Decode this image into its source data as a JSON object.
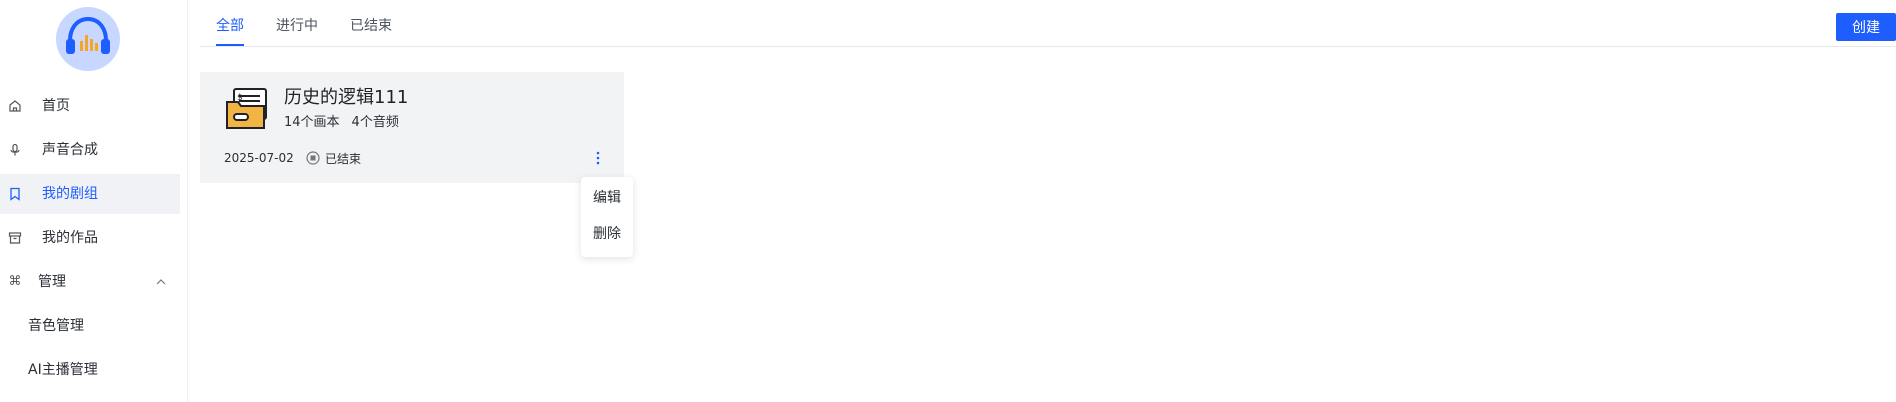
{
  "sidebar": {
    "items": [
      {
        "label": "首页",
        "icon": "home-icon"
      },
      {
        "label": "声音合成",
        "icon": "microphone-icon"
      },
      {
        "label": "我的剧组",
        "icon": "bookmark-icon",
        "active": true
      },
      {
        "label": "我的作品",
        "icon": "archive-icon"
      }
    ],
    "group": {
      "label": "管理",
      "icon": "command-icon",
      "expanded": true,
      "children": [
        {
          "label": "音色管理"
        },
        {
          "label": "AI主播管理"
        }
      ]
    }
  },
  "tabs": [
    {
      "label": "全部",
      "active": true
    },
    {
      "label": "进行中"
    },
    {
      "label": "已结束"
    }
  ],
  "create_label": "创建",
  "card": {
    "title": "历史的逻辑111",
    "picture_count": "14个画本",
    "audio_count": "4个音频",
    "date": "2025-07-02",
    "status": "已结束"
  },
  "dropdown": {
    "items": [
      {
        "label": "编辑"
      },
      {
        "label": "删除"
      }
    ]
  },
  "colors": {
    "accent": "#1e5eff",
    "card_bg": "#f2f3f5",
    "active_nav_bg": "#f0f2f5"
  }
}
